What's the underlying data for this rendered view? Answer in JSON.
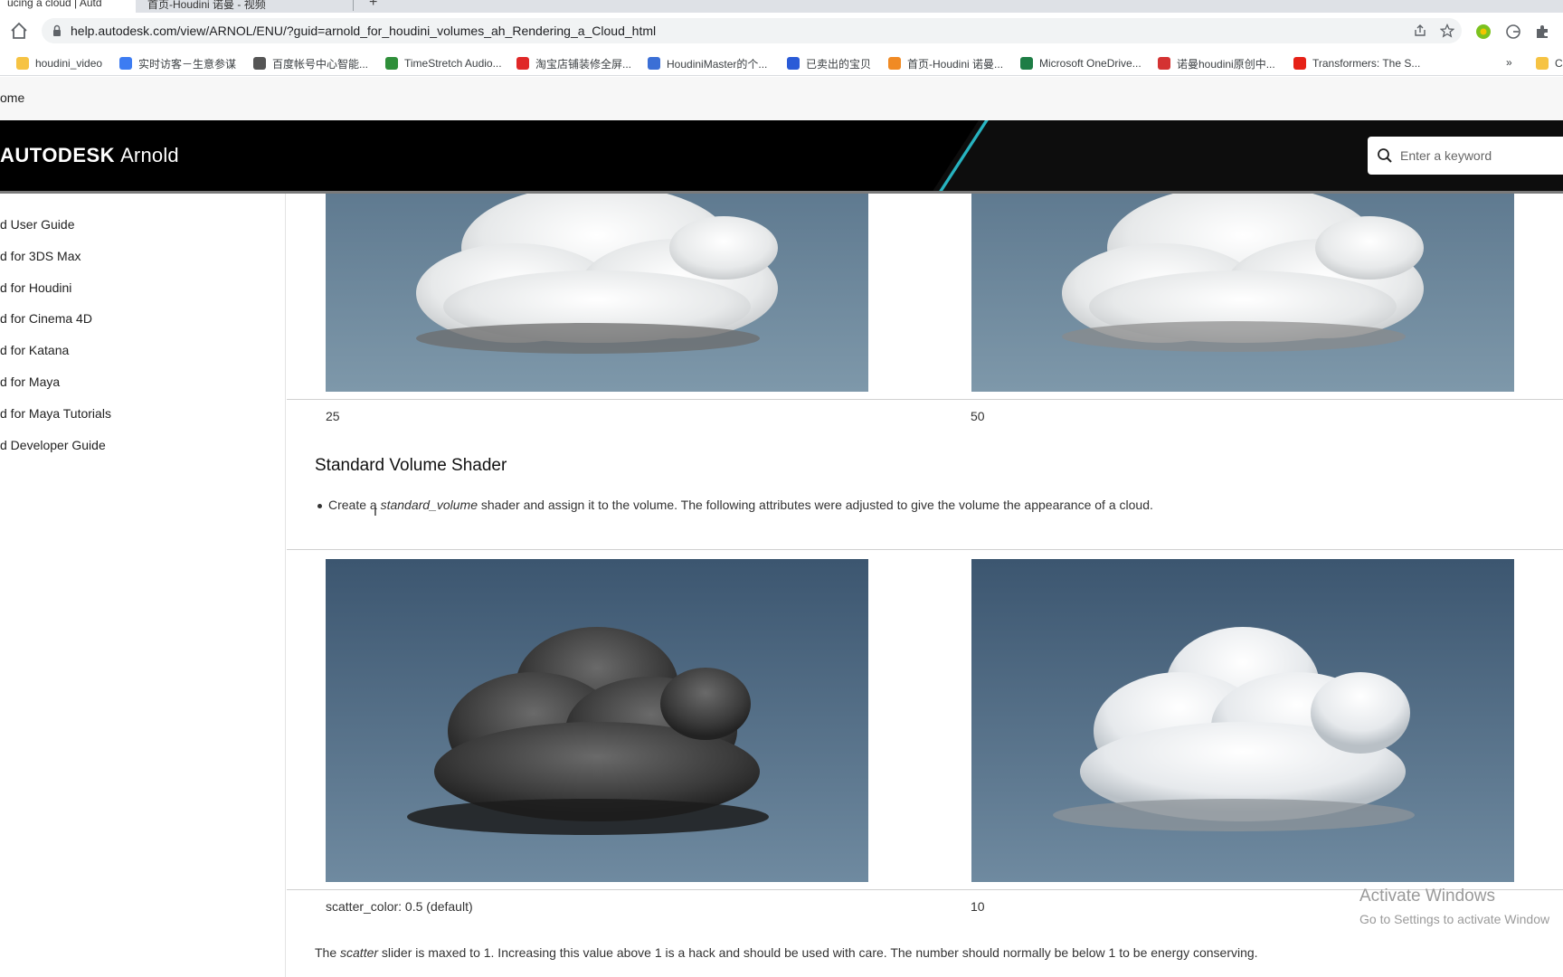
{
  "browser": {
    "tabs": [
      {
        "label": "ucing a cloud | Autd"
      },
      {
        "label": "首页-Houdini 诺曼 - 视频"
      }
    ],
    "url": "help.autodesk.com/view/ARNOL/ENU/?guid=arnold_for_houdini_volumes_ah_Rendering_a_Cloud_html",
    "bookmarks": [
      {
        "label": "houdini_video",
        "color": "#f6c343"
      },
      {
        "label": "实时访客－生意参谋",
        "color": "#3d7cf2"
      },
      {
        "label": "百度帐号中心智能...",
        "color": "#555555"
      },
      {
        "label": "TimeStretch Audio...",
        "color": "#2f8f3a"
      },
      {
        "label": "淘宝店铺装修全屏...",
        "color": "#e02828"
      },
      {
        "label": "HoudiniMaster的个...",
        "color": "#3b6fd6"
      },
      {
        "label": "已卖出的宝贝",
        "color": "#2a5bd7"
      },
      {
        "label": "首页-Houdini 诺曼...",
        "color": "#f08a24"
      },
      {
        "label": "Microsoft OneDrive...",
        "color": "#1e7d45"
      },
      {
        "label": "诺曼houdini原创中...",
        "color": "#d43232"
      },
      {
        "label": "Transformers: The S...",
        "color": "#e62117"
      }
    ],
    "bookmark_overflow": "»",
    "bookmark_folder_tail": "C"
  },
  "site": {
    "breadcrumb_home": "ome",
    "brand_bold": "AUTODESK",
    "brand_product": "Arnold",
    "search_placeholder": "Enter a keyword",
    "accent": "#27b3c0"
  },
  "sidebar": {
    "items": [
      {
        "label": "d User Guide"
      },
      {
        "label": "d for 3DS Max"
      },
      {
        "label": "d for Houdini"
      },
      {
        "label": "d for Cinema 4D"
      },
      {
        "label": "d for Katana"
      },
      {
        "label": "d for Maya"
      },
      {
        "label": "d for Maya Tutorials"
      },
      {
        "label": "d Developer Guide"
      }
    ]
  },
  "content": {
    "top_captions": [
      "25",
      "50"
    ],
    "section_title": "Standard Volume Shader",
    "bullet_pre": "Create a ",
    "bullet_em": "standard_volume",
    "bullet_post": " shader and assign it to the volume. The following attributes were adjusted to give the volume the appearance of a cloud.",
    "bottom_captions": [
      "scatter_color: 0.5 (default)",
      "10"
    ],
    "para_pre": "The ",
    "para_em": "scatter",
    "para_post": " slider is maxed to 1. Increasing this value above 1 is a hack and should be used with care. The number should normally be below 1 to be energy conserving."
  },
  "watermark": {
    "line1": "Activate Windows",
    "line2": "Go to Settings to activate Window"
  }
}
